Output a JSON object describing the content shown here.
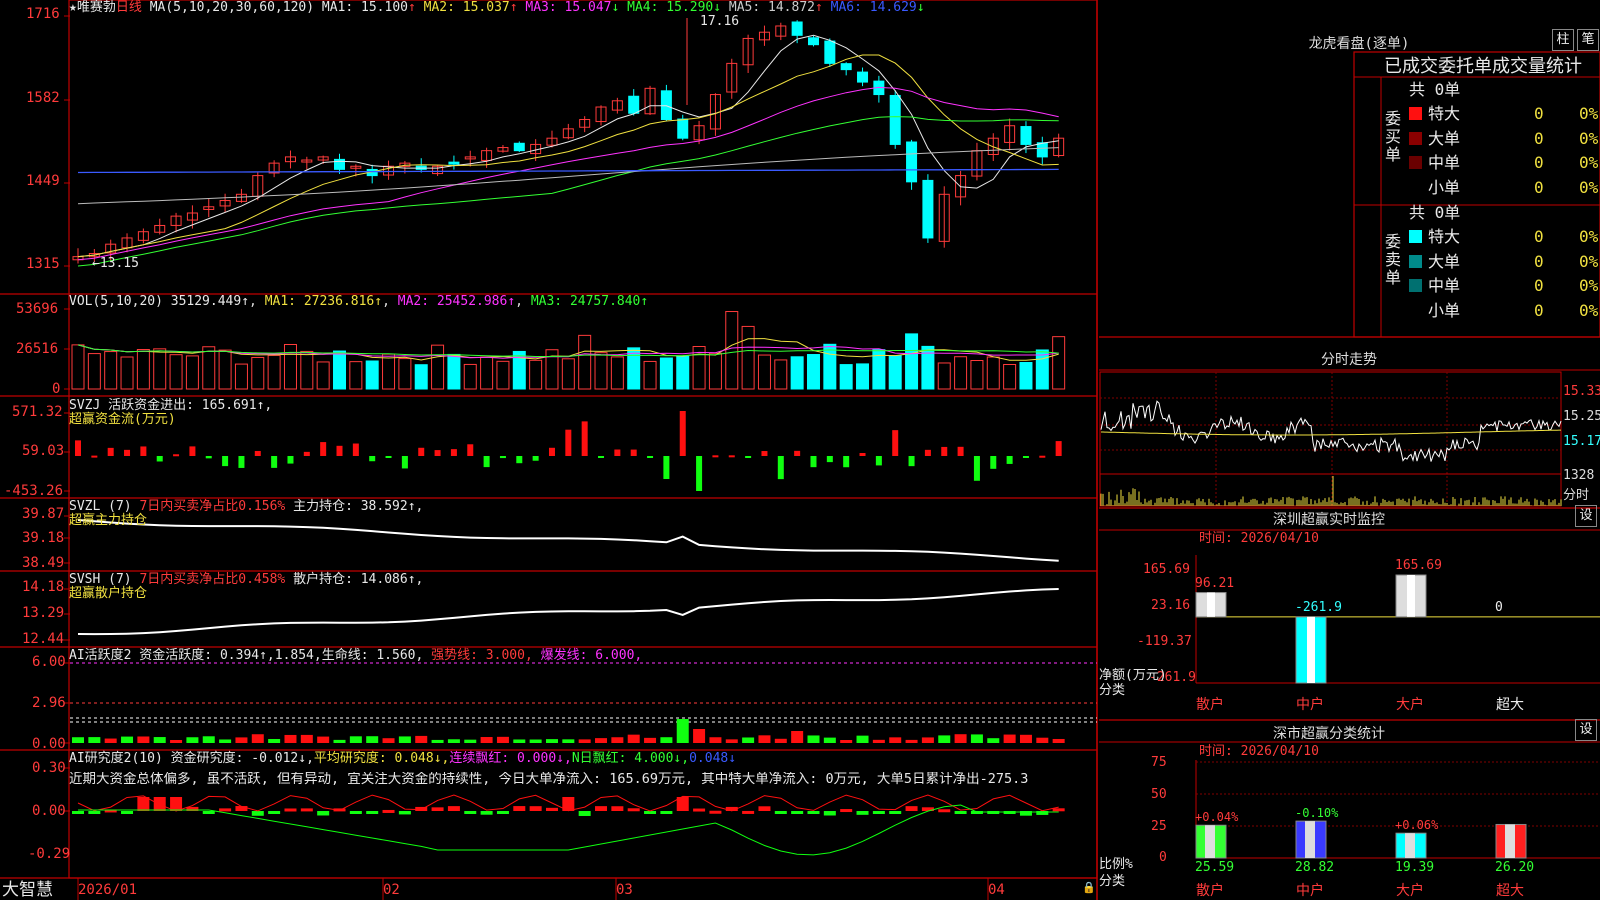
{
  "stock": {
    "name": "唯赛勃",
    "period": "日线",
    "ma_header": "MA(5,10,20,30,60,120)",
    "ma": [
      {
        "label": "MA1:",
        "value": "15.100",
        "arrow": "↑",
        "color": "#e8e8e8"
      },
      {
        "label": "MA2:",
        "value": "15.037",
        "arrow": "↑",
        "color": "#f0e040"
      },
      {
        "label": "MA3:",
        "value": "15.047",
        "arrow": "↓",
        "color": "#ff33ff"
      },
      {
        "label": "MA4:",
        "value": "15.290",
        "arrow": "↓",
        "color": "#33ff33"
      },
      {
        "label": "MA5:",
        "value": "14.872",
        "arrow": "↑",
        "color": "#cccccc"
      },
      {
        "label": "MA6:",
        "value": "14.629",
        "arrow": "↓",
        "color": "#3a5aff"
      }
    ],
    "price_axis": [
      "1716",
      "1582",
      "1449",
      "1315"
    ],
    "high_mark": "17.16",
    "low_mark": "←13.15"
  },
  "volume": {
    "header": "VOL(5,10,20)",
    "value": "35129.449↑",
    "ma1": "MA1: 27236.816↑",
    "ma2": "MA2: 25452.986↑",
    "ma3": "MA3: 24757.840↑",
    "axis": [
      "53696",
      "26516",
      "0"
    ]
  },
  "svzj": {
    "header": "SVZJ  活跃资金进出: 165.691↑,",
    "sub": "超赢资金流(万元)",
    "axis": [
      "571.32",
      "59.03",
      "-453.26"
    ]
  },
  "svzl": {
    "header_a": "SVZL (7)",
    "header_b": "7日内买卖净占比0.156%",
    "header_c": "主力持仓: 38.592↑,",
    "sub": "超赢主力持仓",
    "axis": [
      "39.87",
      "39.18",
      "38.49"
    ]
  },
  "svsh": {
    "header_a": "SVSH (7)",
    "header_b": "7日内买卖净占比0.458%",
    "header_c": "散户持仓: 14.086↑,",
    "sub": "超赢散户持仓",
    "axis": [
      "14.18",
      "13.29",
      "12.44"
    ]
  },
  "ai_active": {
    "header_a": "AI活跃度2 资金活跃度: 0.394↑,1.854,生命线: 1.560,",
    "header_b": "强势线: 3.000,",
    "header_c": "爆发线: 6.000,",
    "axis": [
      "6.00",
      "2.96",
      "0.00"
    ]
  },
  "ai_research": {
    "header_a": "AI研究度2(10)",
    "header_b": "资金研究度: -0.012↓,",
    "header_c": "平均研究度: 0.048↓,",
    "header_d": "连续飘红: 0.000↓,",
    "header_e": "N日飘红: 4.000↓,",
    "header_f": "0.048↓",
    "commentary": "近期大资金总体偏多, 虽不活跃, 但有异动, 宜关注大资金的持续性, 今日大单净流入: 165.69万元, 其中特大单净流入: 0万元, 大单5日累计净出-275.3",
    "axis": [
      "0.30",
      "0.00",
      "-0.29"
    ]
  },
  "date_axis": [
    "2026/01",
    "02",
    "03",
    "04"
  ],
  "brand": "大智慧",
  "right": {
    "top_title": "龙虎看盘(逐单)",
    "btn_zhu": "柱",
    "btn_bi": "笔",
    "tabs_line": "已成交委托单成交量统计",
    "buy": {
      "side": "委买单",
      "total": "共 0单",
      "rows": [
        {
          "label": "特大",
          "count": "0",
          "pct": "0%",
          "color": "#ff1010"
        },
        {
          "label": "大单",
          "count": "0",
          "pct": "0%",
          "color": "#8a0000"
        },
        {
          "label": "中单",
          "count": "0",
          "pct": "0%",
          "color": "#6a0000"
        },
        {
          "label": "小单",
          "count": "0",
          "pct": "0%",
          "color": "#000000"
        }
      ]
    },
    "sell": {
      "side": "委卖单",
      "total": "共 0单",
      "rows": [
        {
          "label": "特大",
          "count": "0",
          "pct": "0%",
          "color": "#00ffff"
        },
        {
          "label": "大单",
          "count": "0",
          "pct": "0%",
          "color": "#008b8b"
        },
        {
          "label": "中单",
          "count": "0",
          "pct": "0%",
          "color": "#007070"
        },
        {
          "label": "小单",
          "count": "0",
          "pct": "0%",
          "color": "#000000"
        }
      ]
    },
    "intraday": {
      "title": "分时走势",
      "axis": [
        "15.33",
        "15.25",
        "15.17",
        "1328"
      ],
      "vol_unit": "分时"
    },
    "monitor": {
      "title": "深圳超赢实时监控",
      "btn": "设",
      "time": "时间: 2026/04/10",
      "axis": [
        "165.69",
        "23.16",
        "-119.37",
        "-261.9"
      ],
      "y_caption": "净额(万元)",
      "x_caption": "分类",
      "categories": [
        "散户",
        "中户",
        "大户",
        "超大"
      ],
      "values": [
        96.21,
        -261.9,
        165.69,
        0
      ],
      "value_labels": [
        "96.21",
        "-261.9",
        "165.69",
        "0"
      ]
    },
    "classify": {
      "title": "深市超赢分类统计",
      "btn": "设",
      "time": "时间: 2026/04/10",
      "axis": [
        "75",
        "50",
        "25",
        "0"
      ],
      "y_caption": "比例%",
      "x_caption": "分类",
      "categories": [
        "散户",
        "中户",
        "大户",
        "超大"
      ],
      "values": [
        25.59,
        28.82,
        19.39,
        26.2
      ],
      "value_labels": [
        "25.59",
        "28.82",
        "19.39",
        "26.20"
      ],
      "change_labels": [
        "+0.04%",
        "-0.10%",
        "+0.06%",
        ""
      ]
    }
  }
}
